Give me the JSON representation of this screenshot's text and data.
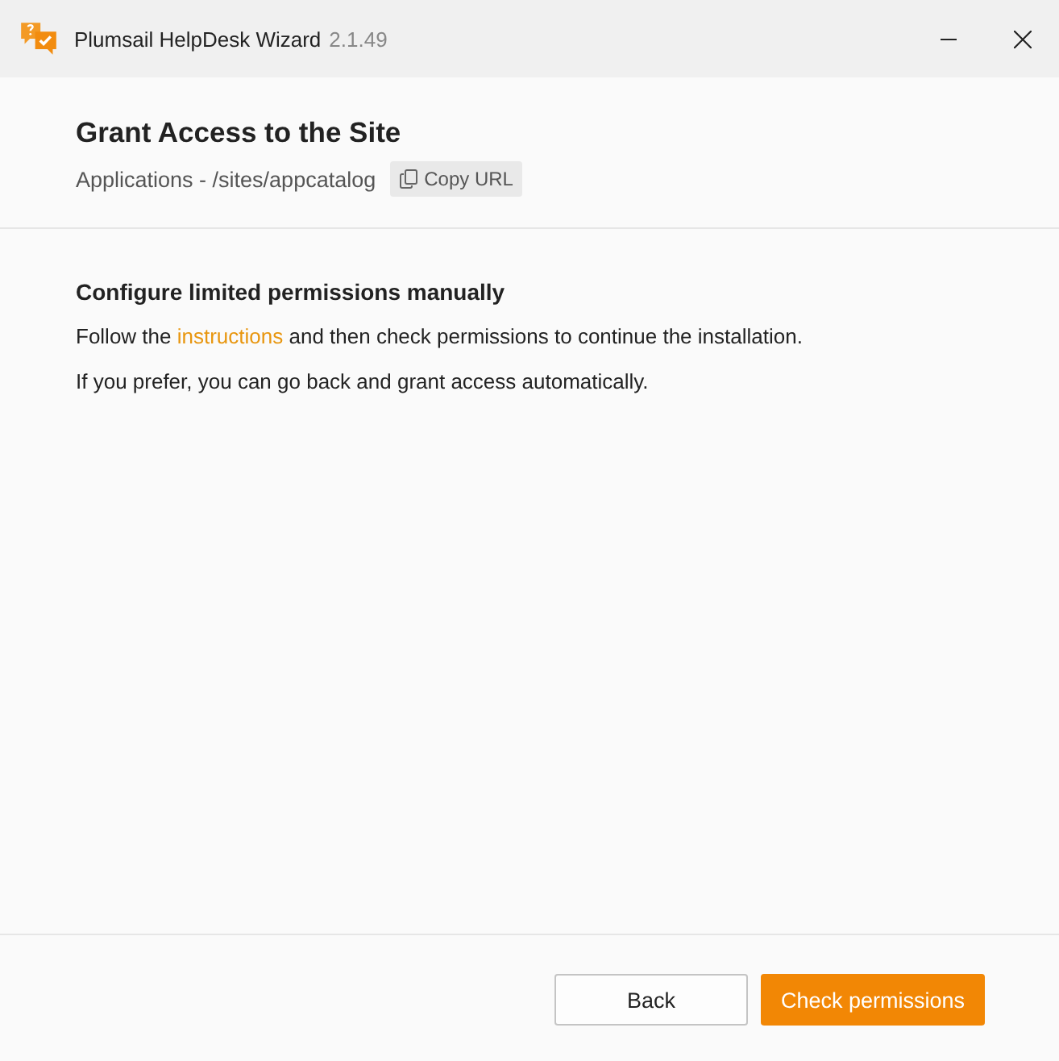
{
  "window": {
    "title": "Plumsail HelpDesk Wizard",
    "version": "2.1.49",
    "controls": [
      {
        "kind": "minimize"
      },
      {
        "kind": "close"
      }
    ]
  },
  "header": {
    "title": "Grant Access to the Site",
    "site_path": "Applications - /sites/appcatalog",
    "copy_button": "Copy URL"
  },
  "section": {
    "heading": "Configure limited permissions manually",
    "paragraphs": [
      [
        {
          "kind": "text",
          "text": "Follow the "
        },
        {
          "kind": "link",
          "text": "instructions"
        },
        {
          "kind": "text",
          "text": " and then check permissions to continue the installation."
        }
      ],
      [
        {
          "kind": "text",
          "text": "If you prefer, you can go back and grant access automatically."
        }
      ]
    ]
  },
  "footer": {
    "buttons": [
      {
        "kind": "secondary",
        "label": "Back"
      },
      {
        "kind": "primary",
        "label": "Check permissions"
      }
    ]
  }
}
